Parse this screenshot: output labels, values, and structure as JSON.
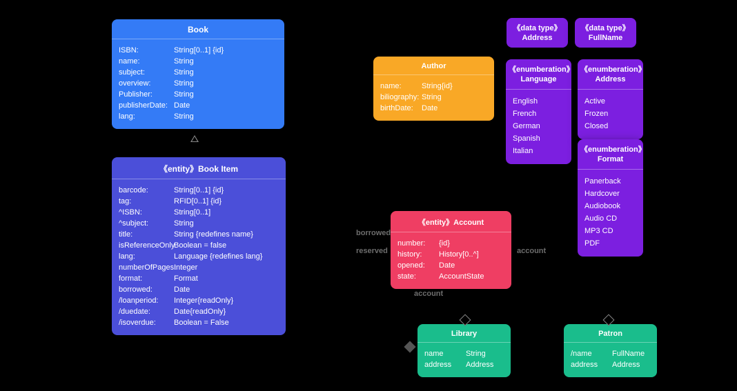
{
  "book": {
    "title": "Book",
    "attrs": [
      {
        "lbl": "ISBN:",
        "val": "String[0..1] {id}"
      },
      {
        "lbl": "name:",
        "val": "String"
      },
      {
        "lbl": "subject:",
        "val": "String"
      },
      {
        "lbl": "overview:",
        "val": "String"
      },
      {
        "lbl": "Publisher:",
        "val": "String"
      },
      {
        "lbl": "publisherDate:",
        "val": "Date"
      },
      {
        "lbl": "lang:",
        "val": "String"
      }
    ]
  },
  "bookItem": {
    "title": "《entity》Book Item",
    "attrs": [
      {
        "lbl": "barcode:",
        "val": "String[0..1] {id}"
      },
      {
        "lbl": "tag:",
        "val": "RFID[0..1] {id}"
      },
      {
        "lbl": "^ISBN:",
        "val": "String[0..1]"
      },
      {
        "lbl": "^subject:",
        "val": "String"
      },
      {
        "lbl": "title:",
        "val": "String {redefines name}"
      },
      {
        "lbl": "isReferenceOnly",
        "val": "Boolean = false"
      },
      {
        "lbl": "lang:",
        "val": "Language {redefines lang}"
      },
      {
        "lbl": "numberOfPages:",
        "val": "Integer"
      },
      {
        "lbl": "format:",
        "val": "Format"
      },
      {
        "lbl": "borrowed:",
        "val": "Date"
      },
      {
        "lbl": "/loanperiod:",
        "val": "Integer{readOnly}"
      },
      {
        "lbl": "/duedate:",
        "val": "Date{readOnly}"
      },
      {
        "lbl": "/isoverdue:",
        "val": "Boolean = False"
      }
    ]
  },
  "author": {
    "title": "Author",
    "attrs": [
      {
        "lbl": "name:",
        "val": "String{id}"
      },
      {
        "lbl": "biliography:",
        "val": "String"
      },
      {
        "lbl": "birthDate:",
        "val": "Date"
      }
    ]
  },
  "account": {
    "title": "《entity》Account",
    "attrs": [
      {
        "lbl": "number:",
        "val": "{id}"
      },
      {
        "lbl": "history:",
        "val": "History[0..^]"
      },
      {
        "lbl": "opened:",
        "val": "Date"
      },
      {
        "lbl": "state:",
        "val": "AccountState"
      }
    ]
  },
  "library": {
    "title": "Library",
    "attrs": [
      {
        "lbl": "name",
        "val": "String"
      },
      {
        "lbl": "address",
        "val": "Address"
      }
    ]
  },
  "patron": {
    "title": "Patron",
    "attrs": [
      {
        "lbl": "/name",
        "val": "FullName"
      },
      {
        "lbl": "address",
        "val": "Address"
      }
    ]
  },
  "dtAddress": {
    "title": "《data type》\nAddress"
  },
  "dtFullName": {
    "title": "《data type》\nFullName"
  },
  "enumLanguage": {
    "title": "《enumberation》\nLanguage",
    "items": [
      "English",
      "French",
      "German",
      "Spanish",
      "Italian"
    ]
  },
  "enumAddress": {
    "title": "《enumberation》\nAddress",
    "items": [
      "Active",
      "Frozen",
      "Closed"
    ]
  },
  "enumFormat": {
    "title": "《enumberation》\nFormat",
    "items": [
      "Panerback",
      "Hardcover",
      "Audiobook",
      "Audio CD",
      "MP3 CD",
      "PDF"
    ]
  },
  "labels": {
    "borrowed": "borrowed",
    "reserved": "reserved",
    "account": "account",
    "account2": "account"
  }
}
